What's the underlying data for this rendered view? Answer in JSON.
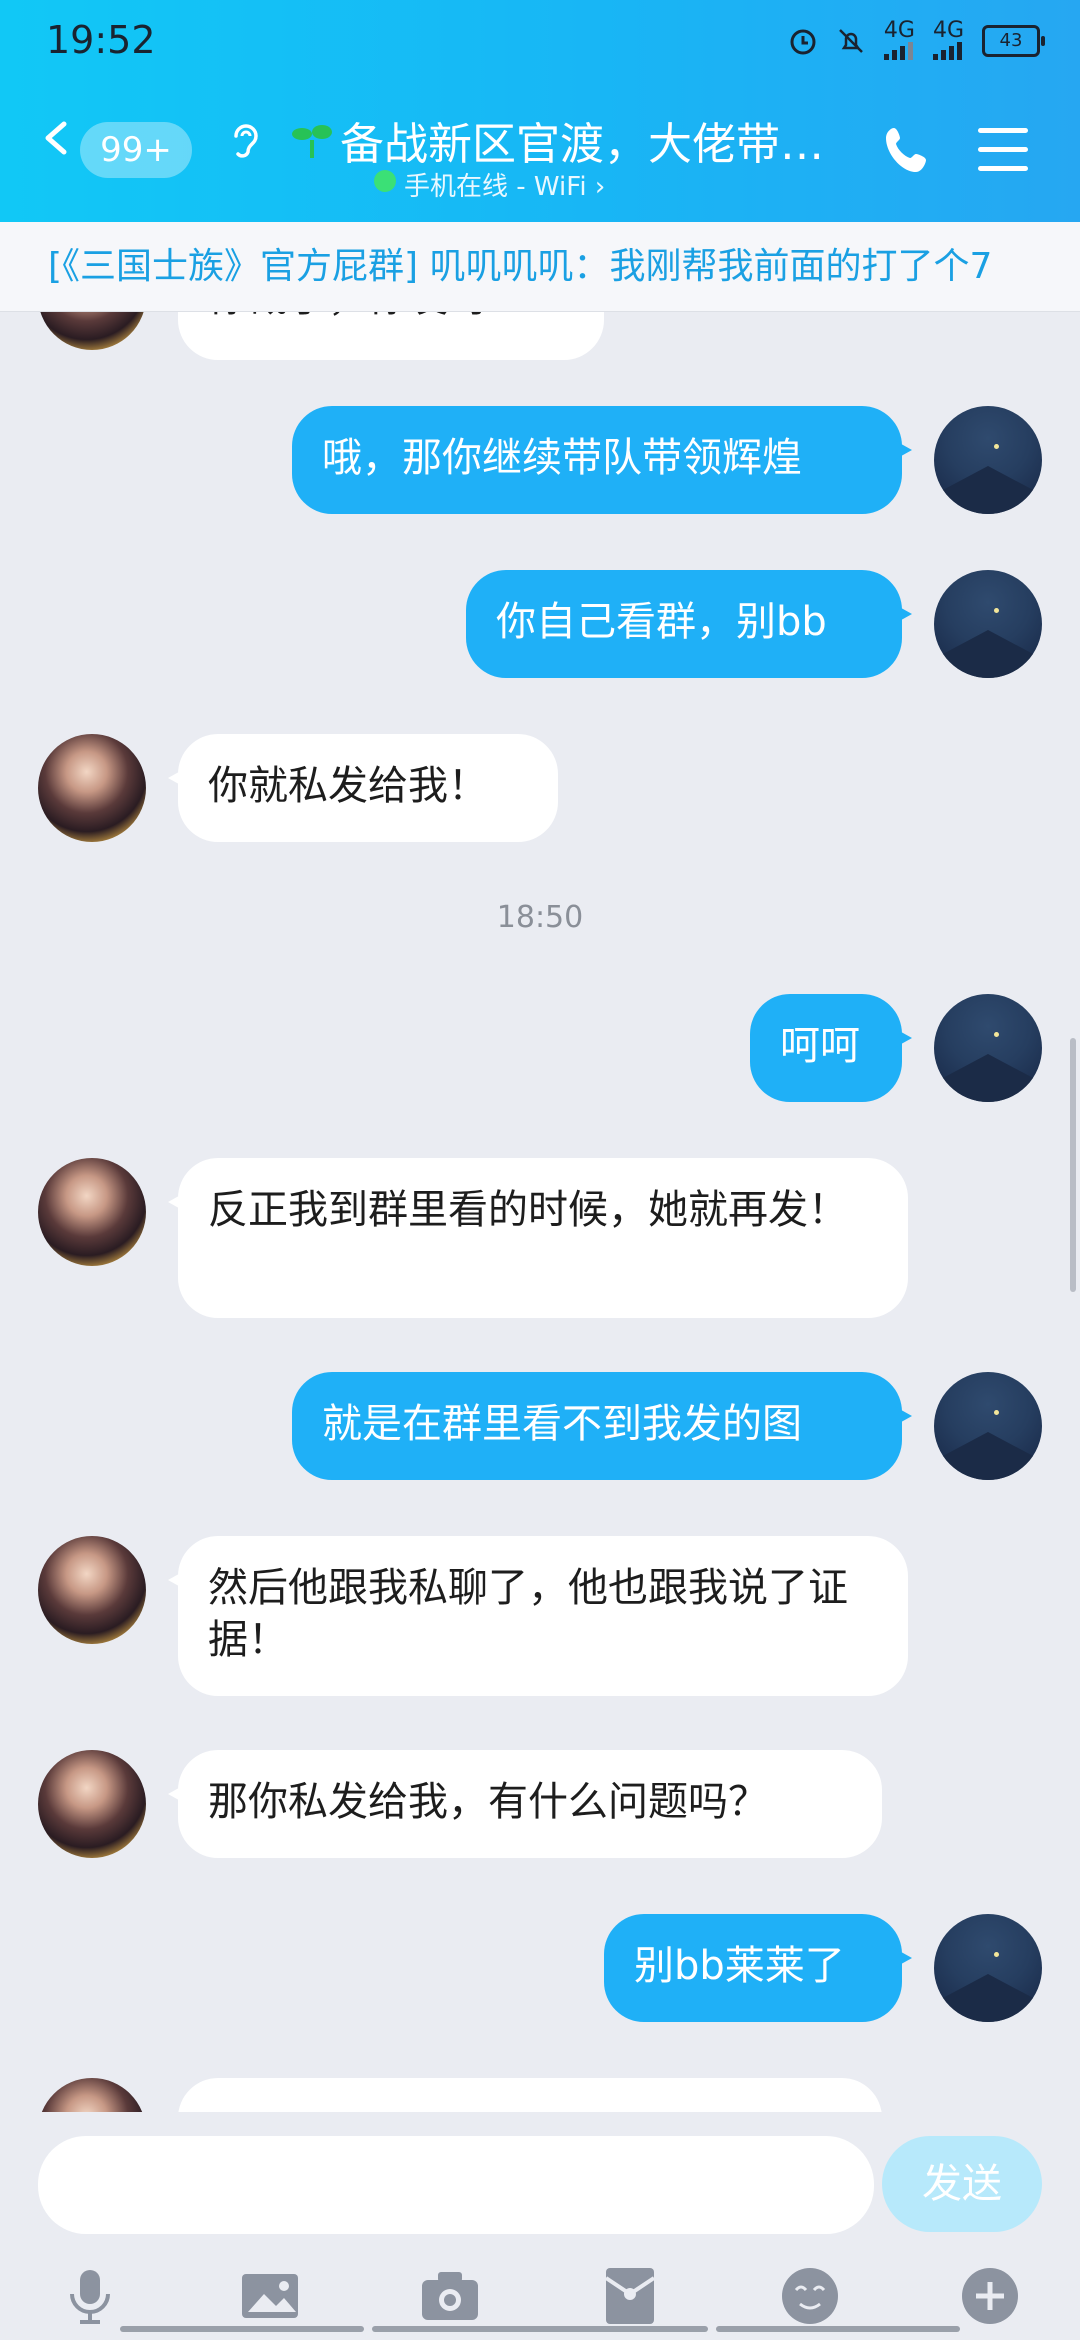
{
  "status_bar": {
    "time": "19:52",
    "network1": "4G",
    "network2": "4G",
    "battery": "43"
  },
  "header": {
    "badge": "99+",
    "title": "备战新区官渡，大佬带…",
    "subtitle": "手机在线 - WiFi ›"
  },
  "notice": "[《三国士族》官方屁群] 叽叽叽叽：我刚帮我前面的打了个7",
  "messages": [
    {
      "side": "other",
      "text": "你截了，你发呀！"
    },
    {
      "side": "self",
      "text": "哦，那你继续带队带领辉煌"
    },
    {
      "side": "self",
      "text": "你自己看群，别bb"
    },
    {
      "side": "other",
      "text": "你就私发给我！"
    },
    {
      "side": "self",
      "text": "呵呵"
    },
    {
      "side": "other",
      "text": "反正我到群里看的时候，她就再发！"
    },
    {
      "side": "self",
      "text": "就是在群里看不到我发的图"
    },
    {
      "side": "other",
      "text": "然后他跟我私聊了，他也跟我说了证据！"
    },
    {
      "side": "other",
      "text": "那你私发给我，有什么问题吗？"
    },
    {
      "side": "self",
      "text": "别bb莱莱了"
    }
  ],
  "timestamp": "18:50",
  "input": {
    "value": "",
    "send_label": "发送"
  },
  "icons": [
    "microphone-icon",
    "image-icon",
    "camera-icon",
    "red-packet-icon",
    "emoji-icon",
    "plus-icon"
  ]
}
